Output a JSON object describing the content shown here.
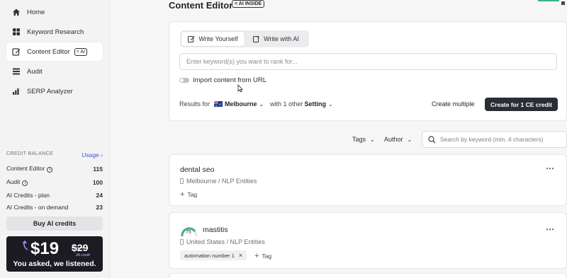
{
  "sidebar": {
    "items": [
      {
        "label": "Home",
        "icon": "home-icon"
      },
      {
        "label": "Keyword Research",
        "icon": "grid-icon"
      },
      {
        "label": "Content Editor",
        "icon": "edit-icon",
        "badge": "AI",
        "active": true
      },
      {
        "label": "Audit",
        "icon": "list-icon"
      },
      {
        "label": "SERP Analyzer",
        "icon": "bar-chart-icon"
      }
    ],
    "credit_balance": {
      "heading": "CREDIT BALANCE",
      "usage_label": "Usage",
      "rows": [
        {
          "label": "Content Editor",
          "value": "115"
        },
        {
          "label": "Audit",
          "value": "100"
        },
        {
          "label": "AI Credits - plan",
          "value": "24"
        },
        {
          "label": "AI Credits - on demand",
          "value": "23"
        }
      ]
    },
    "buy_label": "Buy AI credits",
    "promo": {
      "price": "$19",
      "old_price": "$29",
      "sub": "/AI credit",
      "tagline": "You asked, we listened."
    }
  },
  "header": {
    "title": "Content Editor",
    "ai_badge": "AI INSIDE"
  },
  "editor_panel": {
    "tabs": [
      {
        "label": "Write Yourself",
        "active": true
      },
      {
        "label": "Write with AI",
        "active": false
      }
    ],
    "keyword_placeholder": "Enter keyword(s) you want to rank for...",
    "import_label": "Import content from URL",
    "results_for_label": "Results for",
    "location": "Melbourne",
    "other_prefix": "with 1 other",
    "other_setting": "Setting",
    "create_multiple_label": "Create multiple",
    "create_button_label": "Create for 1 CE credit"
  },
  "filters": {
    "tags_label": "Tags",
    "author_label": "Author",
    "search_placeholder": "Search by keyword (min. 4 characters)"
  },
  "documents": [
    {
      "title": "dental seo",
      "meta": "Melbourne / NLP Entities",
      "tags": [],
      "add_tag_label": "Tag"
    },
    {
      "title": "mastitis",
      "meta": "United States / NLP Entities",
      "score": "75",
      "tags": [
        "automation number 1"
      ],
      "add_tag_label": "Tag"
    }
  ],
  "colors": {
    "accent": "#3b5bcc",
    "primary_button": "#2a2d35",
    "gauge_green": "#3fb37f"
  }
}
